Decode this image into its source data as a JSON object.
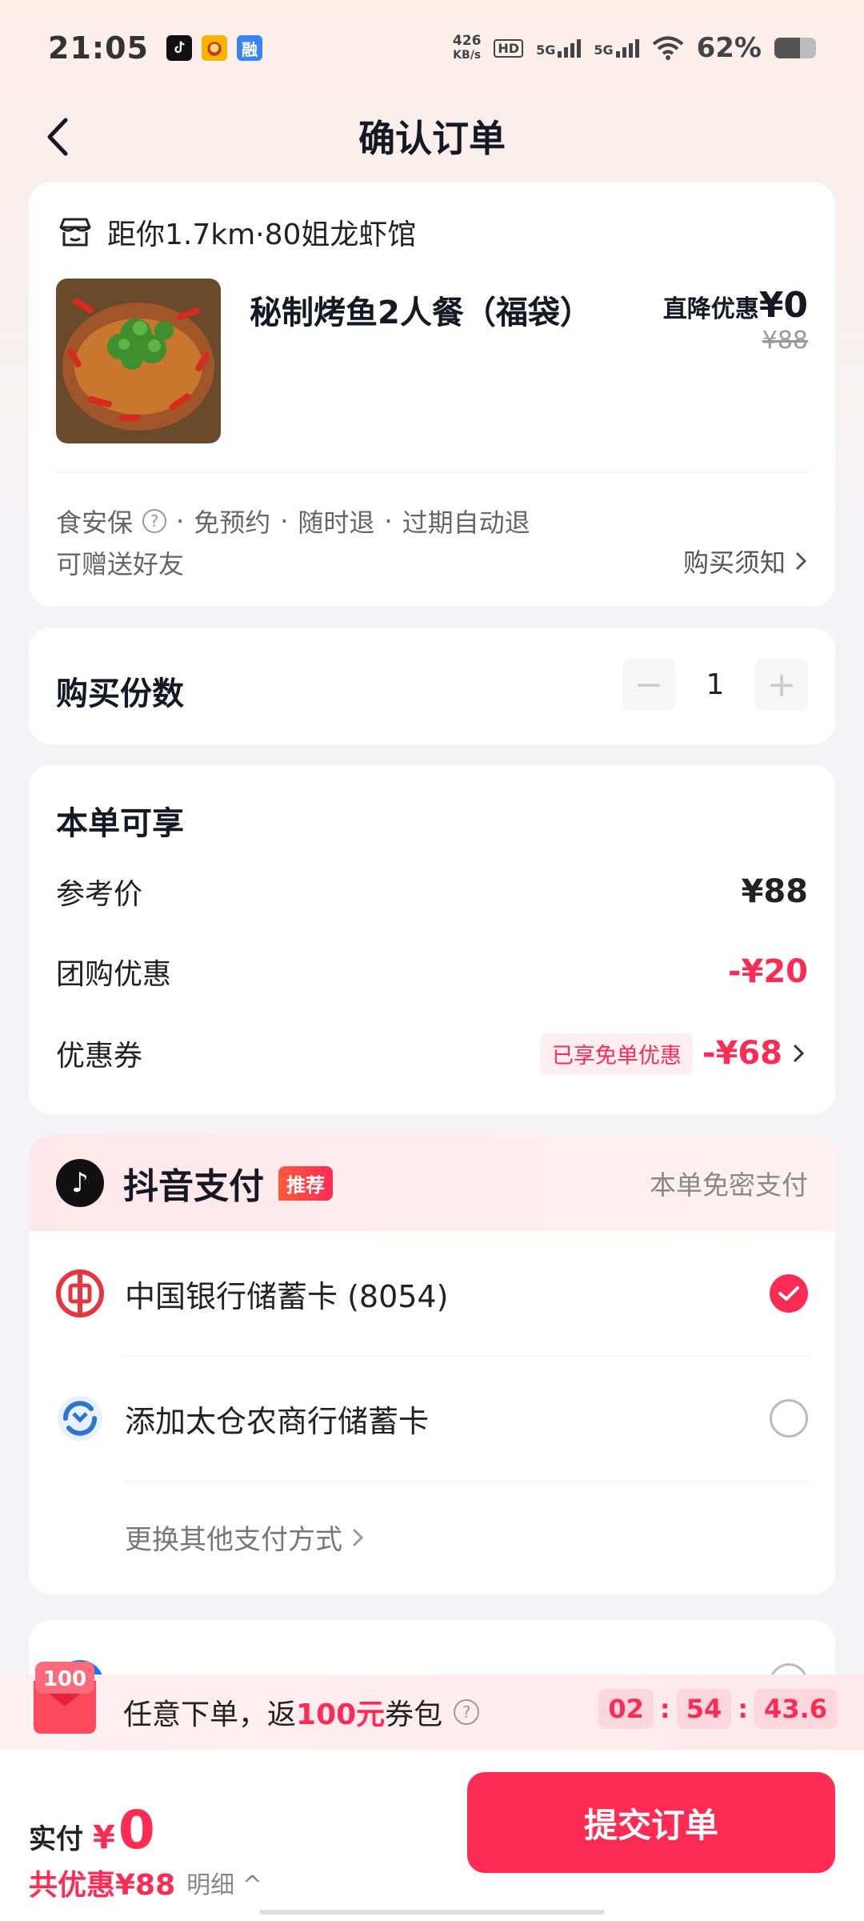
{
  "status_bar": {
    "time": "21:05",
    "net_speed_value": "426",
    "net_speed_unit": "KB/s",
    "hd_tag": "HD",
    "sig1": "5G",
    "sig2": "5G",
    "battery_pct_text": "62%",
    "battery_level": 0.62,
    "app_icons": [
      "tiktok-icon",
      "game-icon",
      "bank-app-icon"
    ],
    "app3_glyph": "融"
  },
  "header": {
    "title": "确认订单",
    "back_icon": "chevron-left-icon"
  },
  "product": {
    "store": "距你1.7km·80姐龙虾馆",
    "name": "秘制烤鱼2人餐（福袋）",
    "discount_label": "直降优惠",
    "discount_value": "¥0",
    "original_price": "¥88",
    "tags": [
      "食安保",
      "免预约",
      "随时退",
      "过期自动退"
    ],
    "tag_sep": "·",
    "help_glyph": "?",
    "gift": "可赠送好友",
    "notice": "购买须知"
  },
  "quantity": {
    "label": "购买份数",
    "value": "1",
    "minus": "−",
    "plus": "+"
  },
  "discounts": {
    "title": "本单可享",
    "rows": [
      {
        "label": "参考价",
        "value": "¥88"
      },
      {
        "label": "团购优惠",
        "value": "-¥20"
      },
      {
        "label": "优惠券",
        "tag": "已享免单优惠",
        "value": "-¥68"
      }
    ]
  },
  "payment": {
    "logo_glyph": "♪",
    "title": "抖音支付",
    "badge": "推荐",
    "subtitle": "本单免密支付",
    "options": [
      {
        "name": "中国银行储蓄卡 (8054)",
        "selected": true,
        "icon": "boc-icon"
      },
      {
        "name": "添加太仓农商行储蓄卡",
        "selected": false,
        "icon": "taicang-bank-icon"
      }
    ],
    "more": "更换其他支付方式"
  },
  "promo": {
    "badge": "100",
    "text_pre": "任意下单，返",
    "text_hl": "100元",
    "text_post": "券包",
    "help_glyph": "?",
    "timer": [
      "02",
      "54",
      "43.6"
    ],
    "timer_sep": ":"
  },
  "bottom": {
    "pay_label": "实付",
    "currency": "¥",
    "amount": "0",
    "saved": "共优惠¥88",
    "detail": "明细",
    "detail_caret": "^",
    "submit": "提交订单"
  },
  "colors": {
    "accent": "#fe2c55",
    "text": "#161823",
    "muted": "#888888"
  }
}
